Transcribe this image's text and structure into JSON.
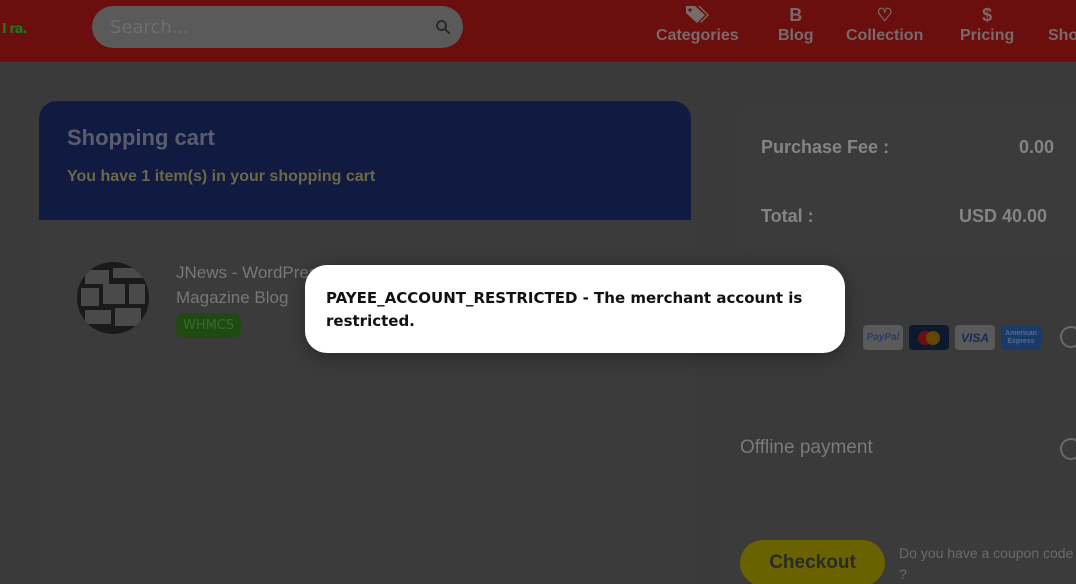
{
  "header": {
    "logo_text": "I ra.",
    "search": {
      "placeholder": "Search..."
    },
    "nav": [
      {
        "label": "Categories",
        "icon": "tags-icon"
      },
      {
        "label": "Blog",
        "icon": "bold-b-icon"
      },
      {
        "label": "Collection",
        "icon": "heart-icon"
      },
      {
        "label": "Pricing",
        "icon": "dollar-icon"
      },
      {
        "label": "Sho",
        "icon": ""
      }
    ]
  },
  "cart": {
    "title": "Shopping cart",
    "subtitle": "You have 1 item(s) in your shopping cart",
    "item": {
      "name_line1": "JNews - WordPress N",
      "name_line2": "Magazine Blog",
      "tag": "WHMCS"
    }
  },
  "summary": {
    "purchase_fee_label": "Purchase Fee :",
    "purchase_fee_value": "0.00",
    "total_label": "Total :",
    "total_value": "USD 40.00"
  },
  "payment": {
    "methods": [
      "PayPal",
      "MasterCard",
      "VISA",
      "American Express"
    ],
    "offline_label": "Offline payment"
  },
  "checkout": {
    "button_label": "Checkout",
    "coupon_prompt": "Do you have a coupon code ?"
  },
  "modal": {
    "message": "PAYEE_ACCOUNT_RESTRICTED - The merchant account is restricted."
  },
  "colors": {
    "header_bg": "#6a0e0e",
    "cart_header_bg": "#111a40",
    "checkout_bg": "#6a6200",
    "tag_bg": "#1f4a12",
    "modal_bg": "#ffffff"
  }
}
